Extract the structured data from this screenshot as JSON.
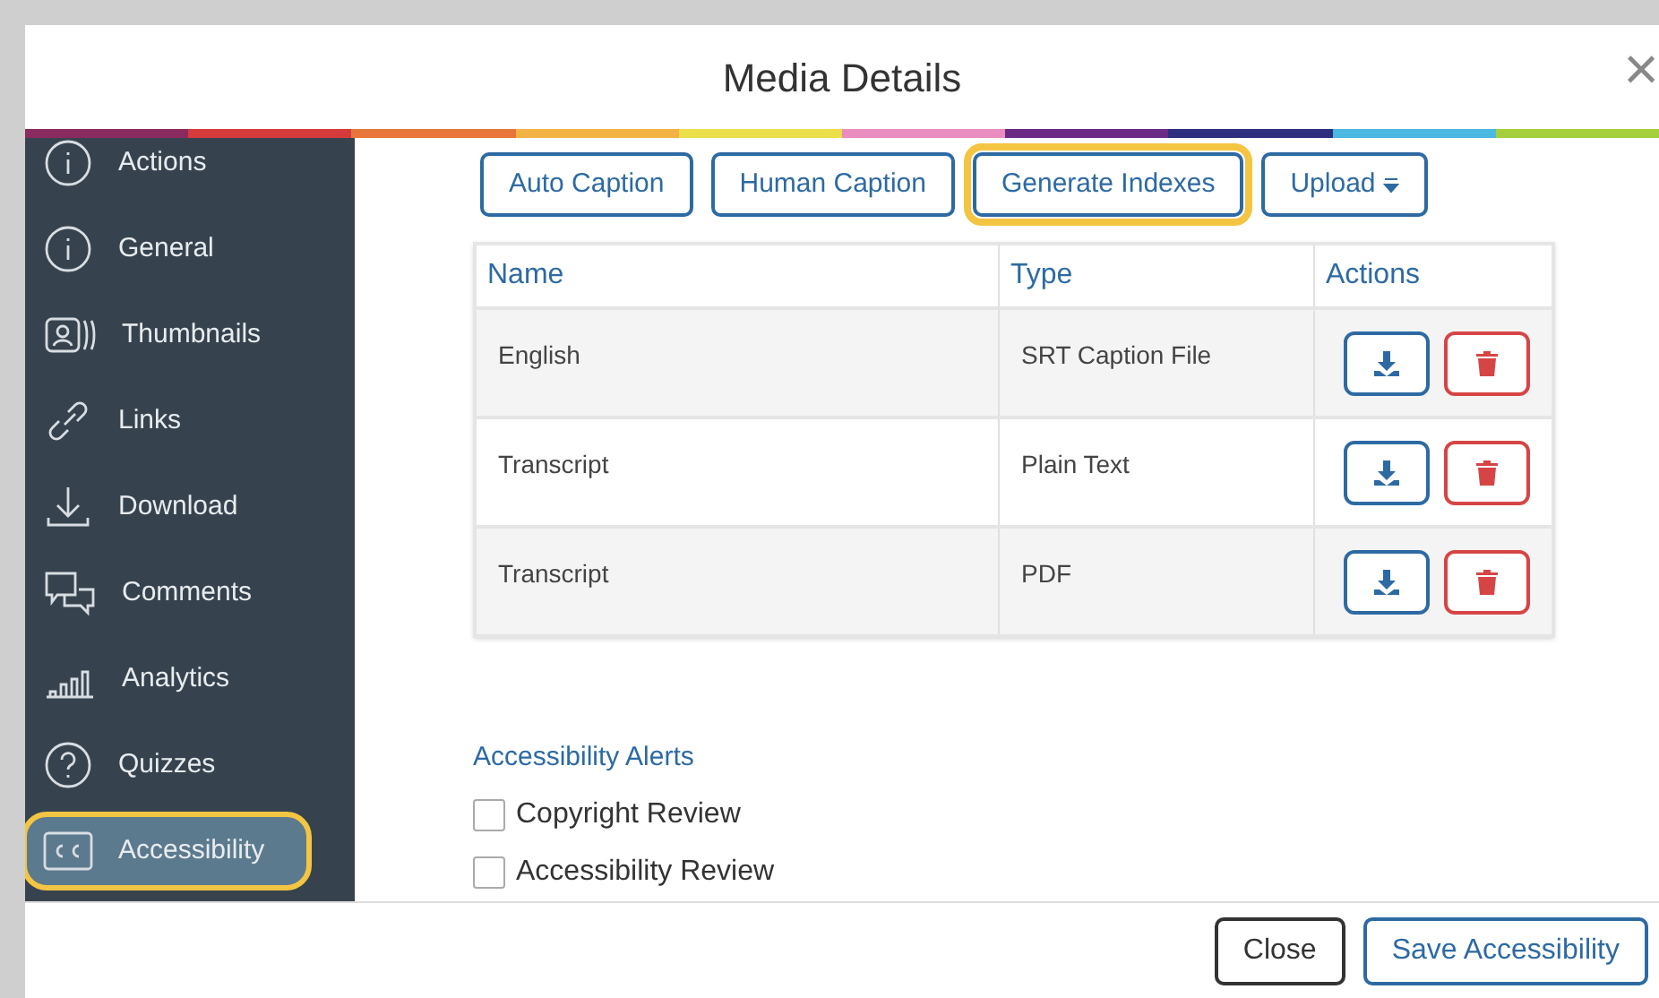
{
  "dialog": {
    "title": "Media Details",
    "close": "×"
  },
  "sidebar": {
    "items": [
      {
        "label": "Actions",
        "selected": false,
        "highlighted": false
      },
      {
        "label": "General",
        "selected": false,
        "highlighted": false
      },
      {
        "label": "Thumbnails",
        "selected": false,
        "highlighted": false
      },
      {
        "label": "Links",
        "selected": false,
        "highlighted": false
      },
      {
        "label": "Download",
        "selected": false,
        "highlighted": false
      },
      {
        "label": "Comments",
        "selected": false,
        "highlighted": false
      },
      {
        "label": "Analytics",
        "selected": false,
        "highlighted": false
      },
      {
        "label": "Quizzes",
        "selected": false,
        "highlighted": false
      },
      {
        "label": "Accessibility",
        "selected": true,
        "highlighted": true
      }
    ]
  },
  "toolbar": [
    {
      "label": "Auto Caption",
      "highlighted": false,
      "menu": false
    },
    {
      "label": "Human Caption",
      "highlighted": false,
      "menu": false
    },
    {
      "label": "Generate Indexes",
      "highlighted": true,
      "menu": false
    },
    {
      "label": "Upload",
      "highlighted": false,
      "menu": true
    }
  ],
  "table": {
    "columns": [
      "Name",
      "Type",
      "Actions"
    ],
    "rows": [
      {
        "name": "English",
        "type": "SRT Caption File"
      },
      {
        "name": "Transcript",
        "type": "Plain Text"
      },
      {
        "name": "Transcript",
        "type": "PDF"
      }
    ]
  },
  "alerts": {
    "title": "Accessibility Alerts",
    "items": [
      {
        "label": "Copyright Review",
        "checked": false
      },
      {
        "label": "Accessibility Review",
        "checked": false
      }
    ]
  },
  "footer": {
    "buttons": [
      {
        "label": "Close",
        "kind": "secondary"
      },
      {
        "label": "Save Accessibility",
        "kind": "primary"
      }
    ]
  }
}
